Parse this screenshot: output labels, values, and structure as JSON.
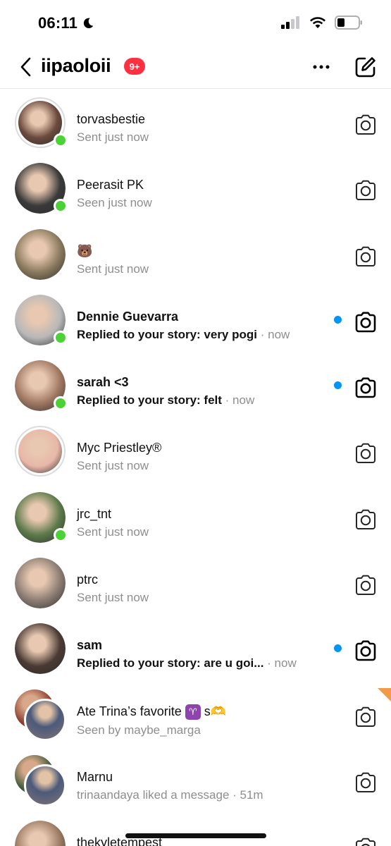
{
  "status_bar": {
    "time": "06:11"
  },
  "header": {
    "account": "iipaoloii",
    "badge": "9+"
  },
  "threads": [
    {
      "name": "torvasbestie",
      "sub": "Sent just now",
      "unread": false,
      "online": true,
      "ring": true,
      "avatar_color": "#6b4a3e"
    },
    {
      "name": "Peerasit PK",
      "sub": "Seen just now",
      "unread": false,
      "online": true,
      "ring": false,
      "avatar_color": "#3a3a3a"
    },
    {
      "name": "🐻",
      "sub": "Sent just now",
      "unread": false,
      "online": false,
      "ring": false,
      "avatar_color": "#8a7a5e"
    },
    {
      "name": "Dennie Guevarra",
      "sub": "Replied to your story: very pogi",
      "time": "· now",
      "unread": true,
      "online": true,
      "ring": false,
      "avatar_color": "#b8b8b8"
    },
    {
      "name": "sarah <3",
      "sub": "Replied to your story: felt",
      "time": "· now",
      "unread": true,
      "online": true,
      "ring": false,
      "avatar_color": "#a07862"
    },
    {
      "name": "Myc Priestley®",
      "sub": "Sent just now",
      "unread": false,
      "online": false,
      "ring": true,
      "avatar_color": "#e8b7a8"
    },
    {
      "name": "jrc_tnt",
      "sub": "Sent just now",
      "unread": false,
      "online": true,
      "ring": false,
      "avatar_color": "#5c7a4a"
    },
    {
      "name": "ptrc",
      "sub": "Sent just now",
      "unread": false,
      "online": false,
      "ring": false,
      "avatar_color": "#8c7d74"
    },
    {
      "name": "sam",
      "sub": "Replied to your story: are u goi...",
      "time": "· now",
      "unread": true,
      "online": false,
      "ring": false,
      "avatar_color": "#4a3a34"
    },
    {
      "name": "Ate Trina’s favorite",
      "name_tag": "♈",
      "name_suffix": "s🫶",
      "sub": "Seen by maybe_marga",
      "unread": false,
      "group": true,
      "avatar_color": "#8a3b2e",
      "avatar_color_b": "#6c6a78"
    },
    {
      "name": "Marnu",
      "sub": "trinaandaya liked a message · 51m",
      "unread": false,
      "group": true,
      "avatar_color": "#3f5a3a",
      "avatar_color_b": "#6c6a78"
    },
    {
      "name": "thekyletempest",
      "sub": "",
      "unread": false,
      "online": false,
      "ring": false,
      "avatar_color": "#9a7a62"
    }
  ],
  "colors": {
    "online": "#4cd137",
    "unread": "#0095f6",
    "badge": "#ff3040"
  }
}
